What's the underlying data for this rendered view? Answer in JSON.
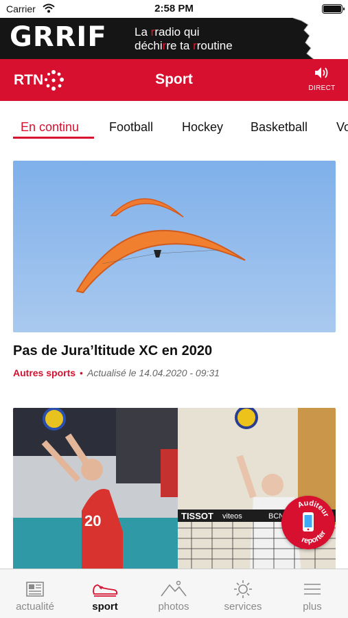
{
  "status_bar": {
    "carrier": "Carrier",
    "time": "2:58 PM"
  },
  "ad": {
    "logo": "GRRIF",
    "tagline_line1_a": "La ",
    "tagline_line1_accent": "r",
    "tagline_line1_b": "radio qui",
    "tagline_line2_a": "déchi",
    "tagline_line2_accent": "r",
    "tagline_line2_b": "re ta ",
    "tagline_line2_accent2": "r",
    "tagline_line2_c": "routine"
  },
  "header": {
    "logo": "RTN",
    "title": "Sport",
    "direct_label": "DIRECT"
  },
  "tabs": [
    {
      "label": "En continu",
      "active": true
    },
    {
      "label": "Football"
    },
    {
      "label": "Hockey"
    },
    {
      "label": "Basketball"
    },
    {
      "label": "Vo"
    }
  ],
  "articles": [
    {
      "title": "Pas de Jura’ltitude XC en 2020",
      "category": "Autres sports",
      "separator": "•",
      "date": "Actualisé le 14.04.2020 - 09:31",
      "image": "paragliders-sky"
    },
    {
      "title": "",
      "image": "volleyball-players",
      "scoreboard_text": "20",
      "banner_text": "TISSOT",
      "banner_text2": "viteos",
      "banner_text3": "BCN"
    }
  ],
  "reporter_badge": {
    "line1": "Auditeur",
    "line2": "reporter"
  },
  "tabbar": [
    {
      "label": "actualité",
      "icon": "newspaper-icon"
    },
    {
      "label": "sport",
      "icon": "sneaker-icon",
      "active": true
    },
    {
      "label": "photos",
      "icon": "mountains-icon"
    },
    {
      "label": "services",
      "icon": "sun-icon"
    },
    {
      "label": "plus",
      "icon": "menu-icon"
    }
  ],
  "colors": {
    "brand": "#d6102e",
    "ad_bg": "#151515",
    "sky": "#8fb6e6"
  }
}
